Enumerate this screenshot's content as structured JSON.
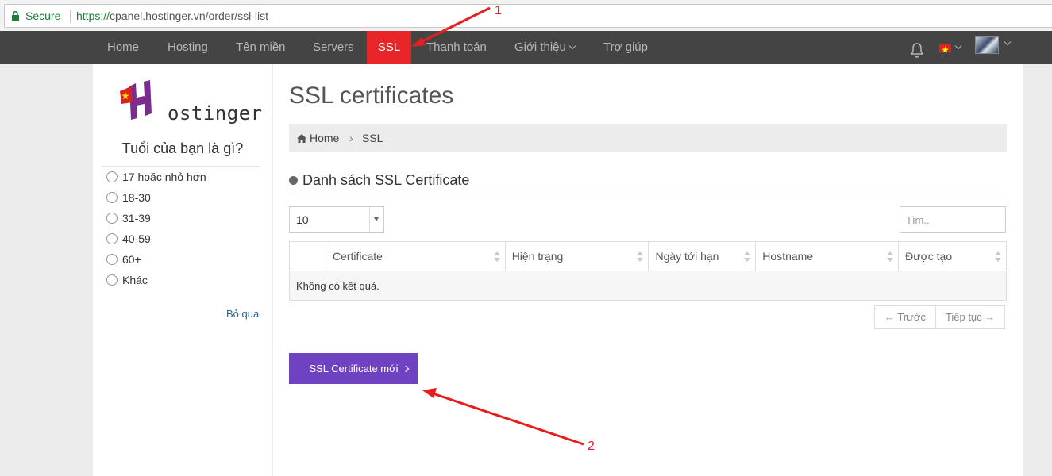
{
  "browser": {
    "secure_label": "Secure",
    "url_protocol": "https://",
    "url_rest": "cpanel.hostinger.vn/order/ssl-list"
  },
  "nav": {
    "items": [
      {
        "label": "Home"
      },
      {
        "label": "Hosting"
      },
      {
        "label": "Tên miền"
      },
      {
        "label": "Servers"
      },
      {
        "label": "SSL"
      },
      {
        "label": "Thanh toán"
      },
      {
        "label": "Giới thiệu"
      },
      {
        "label": "Trợ giúp"
      }
    ],
    "active_color": "#e8262a",
    "bg_color": "#444444"
  },
  "sidebar": {
    "logo_text": "ostinger",
    "survey_title": "Tuổi của bạn là gì?",
    "options": [
      "17 hoặc nhỏ hơn",
      "18-30",
      "31-39",
      "40-59",
      "60+",
      "Khác"
    ],
    "skip_label": "Bỏ qua"
  },
  "main": {
    "title": "SSL certificates",
    "breadcrumb": {
      "home": "Home",
      "separator": "›",
      "current": "SSL"
    },
    "section_title": "Danh sách SSL Certificate",
    "length_value": "10",
    "search_placeholder": "Tìm..",
    "table": {
      "headers": [
        "",
        "Certificate",
        "Hiện trạng",
        "Ngày tới hạn",
        "Hostname",
        "Được tạo"
      ],
      "empty_message": "Không có kết quả."
    },
    "pager": {
      "prev": "← Trước",
      "next": "Tiếp tục →"
    },
    "new_button": "SSL Certificate mới",
    "button_color": "#6f42c1"
  },
  "annotations": {
    "label_1": "1",
    "label_2": "2",
    "color": "#e81e1e"
  }
}
